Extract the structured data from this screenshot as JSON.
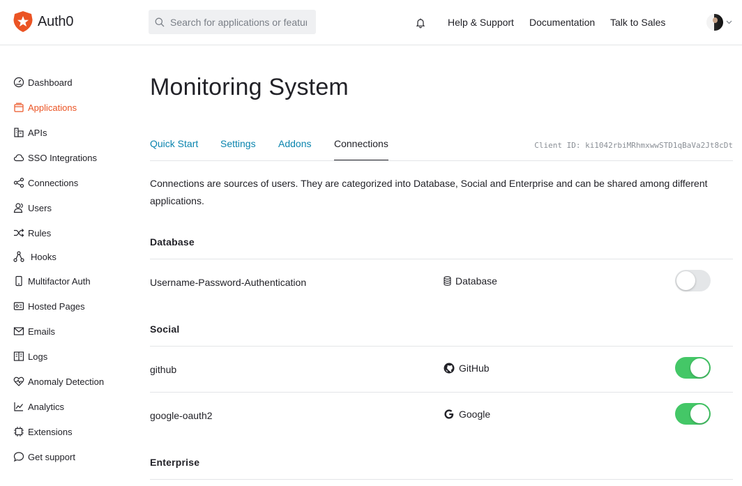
{
  "brand": {
    "name": "Auth0",
    "accent": "#eb5424",
    "link": "#0a84ae",
    "toggle_on": "#44c767"
  },
  "search": {
    "placeholder": "Search for applications or features"
  },
  "header": {
    "links": [
      "Help & Support",
      "Documentation",
      "Talk to Sales"
    ]
  },
  "sidebar": {
    "items": [
      {
        "label": "Dashboard",
        "icon": "dashboard-icon",
        "active": false
      },
      {
        "label": "Applications",
        "icon": "applications-icon",
        "active": true
      },
      {
        "label": "APIs",
        "icon": "apis-icon",
        "active": false
      },
      {
        "label": "SSO Integrations",
        "icon": "cloud-icon",
        "active": false
      },
      {
        "label": "Connections",
        "icon": "connections-icon",
        "active": false
      },
      {
        "label": "Users",
        "icon": "users-icon",
        "active": false
      },
      {
        "label": "Rules",
        "icon": "shuffle-icon",
        "active": false
      },
      {
        "label": "Hooks",
        "icon": "hooks-icon",
        "active": false
      },
      {
        "label": "Multifactor Auth",
        "icon": "phone-icon",
        "active": false
      },
      {
        "label": "Hosted Pages",
        "icon": "hosted-pages-icon",
        "active": false
      },
      {
        "label": "Emails",
        "icon": "mail-icon",
        "active": false
      },
      {
        "label": "Logs",
        "icon": "book-icon",
        "active": false
      },
      {
        "label": "Anomaly Detection",
        "icon": "heart-icon",
        "active": false
      },
      {
        "label": "Analytics",
        "icon": "chart-icon",
        "active": false
      },
      {
        "label": "Extensions",
        "icon": "chip-icon",
        "active": false
      },
      {
        "label": "Get support",
        "icon": "chat-icon",
        "active": false
      }
    ]
  },
  "main": {
    "title": "Monitoring System",
    "tabs": [
      {
        "label": "Quick Start",
        "active": false
      },
      {
        "label": "Settings",
        "active": false
      },
      {
        "label": "Addons",
        "active": false
      },
      {
        "label": "Connections",
        "active": true
      }
    ],
    "client_id": "Client ID: ki1042rbiMRhmxwwSTD1qBaVa2Jt8cDt",
    "description": "Connections are sources of users. They are categorized into Database, Social and Enterprise and can be shared among different applications.",
    "sections": {
      "database": {
        "title": "Database",
        "rows": [
          {
            "name": "Username-Password-Authentication",
            "type": "Database",
            "type_icon": "database-icon",
            "enabled": false
          }
        ]
      },
      "social": {
        "title": "Social",
        "rows": [
          {
            "name": "github",
            "type": "GitHub",
            "type_icon": "github-icon",
            "enabled": true
          },
          {
            "name": "google-oauth2",
            "type": "Google",
            "type_icon": "google-icon",
            "enabled": true
          }
        ]
      },
      "enterprise": {
        "title": "Enterprise"
      }
    }
  }
}
